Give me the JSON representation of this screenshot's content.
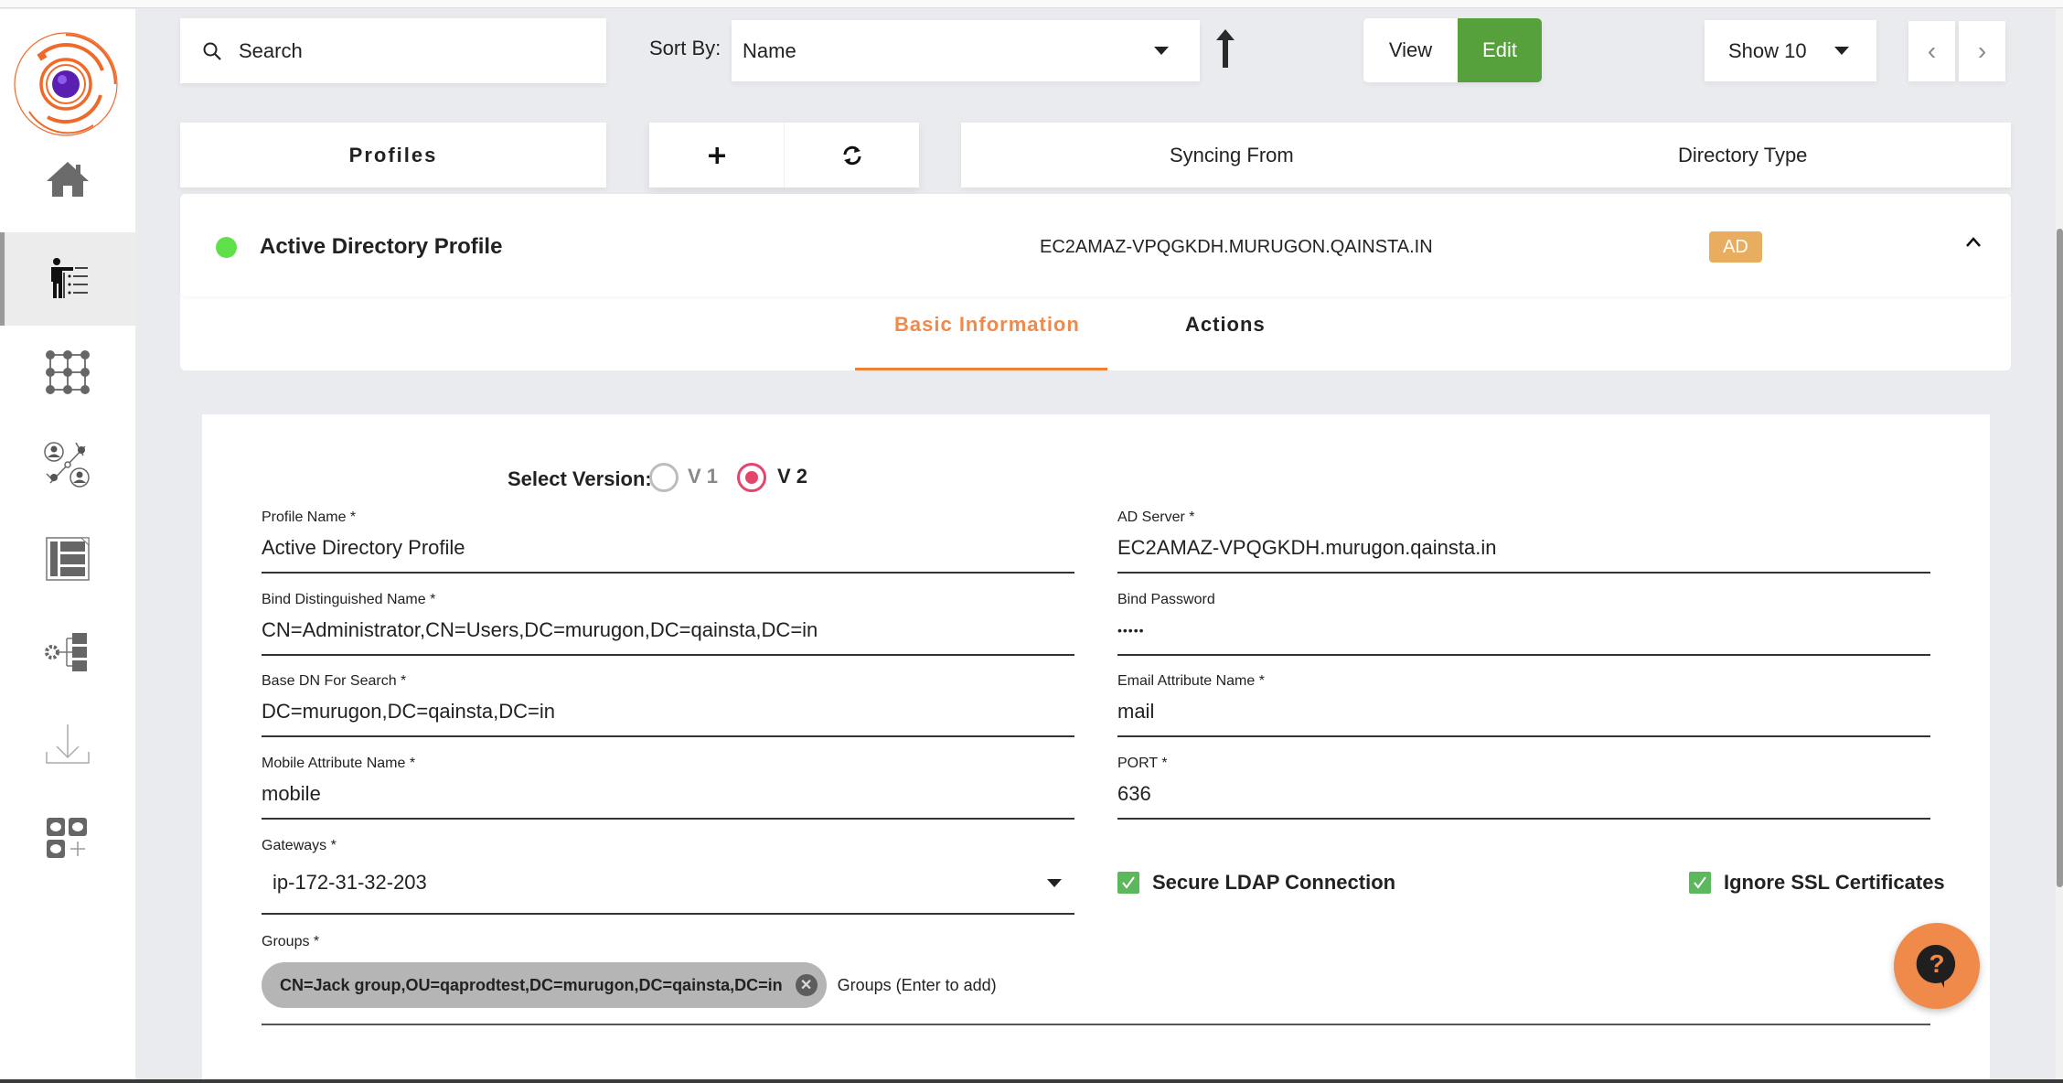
{
  "sidebar": {
    "items": [
      {
        "name": "home",
        "icon": "home-icon",
        "active": false
      },
      {
        "name": "directory-profiles",
        "icon": "presenter-list-icon",
        "active": true
      },
      {
        "name": "grid",
        "icon": "grid-network-icon",
        "active": false
      },
      {
        "name": "user-network",
        "icon": "user-network-icon",
        "active": false
      },
      {
        "name": "layout",
        "icon": "document-layout-icon",
        "active": false
      },
      {
        "name": "settings-folders",
        "icon": "gear-folders-icon",
        "active": false
      },
      {
        "name": "download",
        "icon": "download-icon",
        "active": false
      },
      {
        "name": "add-apps",
        "icon": "add-apps-icon",
        "active": false
      }
    ]
  },
  "toolbar": {
    "search_placeholder": "Search",
    "sort_label": "Sort By:",
    "sort_value": "Name",
    "sort_direction_icon": "arrow-up-icon",
    "view_label": "View",
    "edit_label": "Edit",
    "show_value": "Show 10",
    "prev_glyph": "‹",
    "next_glyph": "›"
  },
  "list_header": {
    "profiles_label": "Profiles",
    "add_glyph": "+",
    "columns": [
      "Syncing From",
      "Directory Type"
    ]
  },
  "profile": {
    "name": "Active Directory Profile",
    "status_color": "#5fe04a",
    "syncing_from": "EC2AMAZ-VPQGKDH.MURUGON.QAINSTA.IN",
    "directory_type": "AD",
    "tabs": [
      {
        "label": "Basic Information",
        "active": true
      },
      {
        "label": "Actions",
        "active": false
      }
    ]
  },
  "form": {
    "version_label": "Select Version:",
    "versions": [
      {
        "label": "V 1",
        "selected": false
      },
      {
        "label": "V 2",
        "selected": true
      }
    ],
    "fields": {
      "profile_name": {
        "label": "Profile Name *",
        "value": "Active Directory Profile"
      },
      "ad_server": {
        "label": "AD Server *",
        "value": "EC2AMAZ-VPQGKDH.murugon.qainsta.in"
      },
      "bind_dn": {
        "label": "Bind Distinguished Name *",
        "value": "CN=Administrator,CN=Users,DC=murugon,DC=qainsta,DC=in"
      },
      "bind_password": {
        "label": "Bind Password",
        "value": "•••••"
      },
      "base_dn": {
        "label": "Base DN For Search *",
        "value": "DC=murugon,DC=qainsta,DC=in"
      },
      "email_attr": {
        "label": "Email Attribute Name *",
        "value": "mail"
      },
      "mobile_attr": {
        "label": "Mobile Attribute Name *",
        "value": "mobile"
      },
      "port": {
        "label": "PORT *",
        "value": "636"
      },
      "gateways": {
        "label": "Gateways *",
        "value": "ip-172-31-32-203"
      }
    },
    "checkboxes": [
      {
        "label": "Secure LDAP Connection",
        "checked": true
      },
      {
        "label": "Ignore SSL Certificates",
        "checked": true
      }
    ],
    "groups": {
      "label": "Groups *",
      "chips": [
        "CN=Jack group,OU=qaprodtest,DC=murugon,DC=qainsta,DC=in"
      ],
      "placeholder": "Groups (Enter to add)"
    }
  },
  "colors": {
    "accent_orange": "#ef8a4a",
    "edit_green": "#56a13b",
    "badge_ad": "#e8ad5e",
    "radio_pink": "#e5456c",
    "checkbox_green": "#5cb85c"
  }
}
